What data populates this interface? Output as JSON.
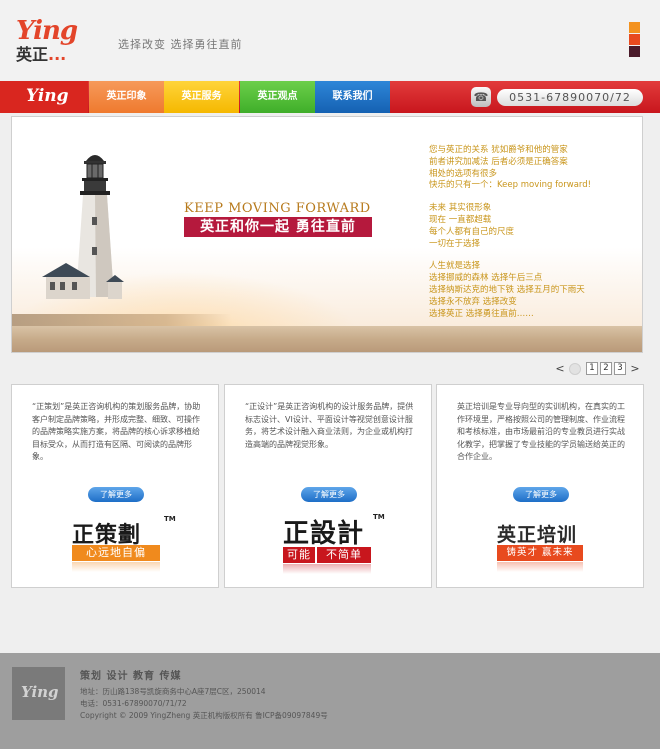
{
  "header": {
    "logo_en": "Ying",
    "logo_cn": "英正",
    "logo_dots": "...",
    "slogan": "选择改变 选择勇往直前"
  },
  "nav": {
    "logo": "Ying",
    "items": [
      "英正印象",
      "英正服务",
      "英正观点",
      "联系我们"
    ],
    "phone": "0531-67890070/72"
  },
  "banner": {
    "tagline_en": "KEEP MOVING FORWARD",
    "tagline_cn": "英正和你一起 勇往直前",
    "lines_1": [
      "您与英正的关系   犹如爵爷和他的管家",
      "前者讲究加减法   后者必须是正确答案",
      "相处的选项有很多",
      "快乐的只有一个：Keep moving forward!"
    ],
    "lines_2": [
      "未来   其实很形象",
      "现在   一直都超载",
      "每个人都有自己的尺度",
      "一切在于选择"
    ],
    "lines_3": [
      "人生就是选择",
      "选择挪威的森林   选择午后三点",
      "选择纳斯达克的地下铁   选择五月的下雨天",
      "选择永不放弃   选择改变",
      "选择英正   选择勇往直前……"
    ]
  },
  "pager": {
    "prev": "<",
    "next": ">",
    "pages": [
      "1",
      "2",
      "3"
    ]
  },
  "cards": [
    {
      "text": "“正策划”是英正咨询机构的策划服务品牌，协助客户制定品牌策略，并形成完整、细致、可操作的品牌策略实施方案，将品牌的核心诉求移植给目标受众，从而打造有区隔、可阅读的品牌形象。",
      "more": "了解更多",
      "brand": "正策劃",
      "tm": "TM",
      "bar": "心远地自偏"
    },
    {
      "text": "“正设计”是英正咨询机构的设计服务品牌，提供标志设计、VI设计、平面设计等视觉创意设计服务，将艺术设计融入商业法则，为企业或机构打造高端的品牌视觉形象。",
      "more": "了解更多",
      "brand": "正設計",
      "tm": "TM",
      "bar_left": "可能",
      "bar_right": "不简单"
    },
    {
      "text": "英正培训是专业导向型的实训机构，在真实的工作环境里，严格按照公司的管理制度、作业流程和考核标准，由市场最前沿的专业教员进行实战化教学，把掌握了专业技能的学员输送给英正的合作企业。",
      "more": "了解更多",
      "brand": "英正培训",
      "bar": "铸英才 赢未来"
    }
  ],
  "footer": {
    "logo": "Ying",
    "title": "策划 设计 教育 传媒",
    "address": "地址：历山路138号凯旋商务中心A座7层C区，250014",
    "phone": "电话：0531-67890070/71/72",
    "copyright": "Copyright © 2009 YingZheng 英正机构版权所有      鲁ICP备09097849号"
  },
  "colors": {
    "accent_red": "#c8161d",
    "orange": "#ef7a2e",
    "yellow": "#f5b800",
    "green": "#3fae2a",
    "blue": "#1561b2",
    "banner_gold": "#c9961c"
  }
}
